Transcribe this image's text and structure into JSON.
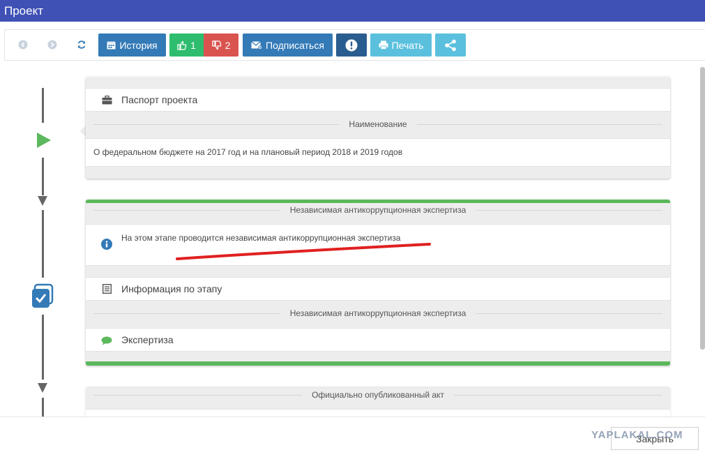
{
  "window": {
    "title": "Проект"
  },
  "toolbar": {
    "history_label": "История",
    "likes_count": "1",
    "dislikes_count": "2",
    "subscribe_label": "Подписаться",
    "print_label": "Печать"
  },
  "passport_card": {
    "header_label": "Паспорт проекта",
    "name_heading": "Наименование",
    "name_value": "О федеральном бюджете на 2017 год и на плановый период 2018 и 2019 годов"
  },
  "expertise_card": {
    "stage_heading": "Независимая антикоррупционная экспертиза",
    "stage_info": "На этом этапе проводится независимая антикоррупционная экспертиза",
    "stage_details_label": "Информация по этапу",
    "sub_heading": "Независимая антикоррупционная экспертиза",
    "expertise_label": "Экспертиза"
  },
  "published_card": {
    "heading": "Официально опубликованный акт"
  },
  "footer": {
    "close_label": "Закрыть",
    "watermark": "YAPLAKAL.COM"
  },
  "colors": {
    "title_bar": "#3f51b5",
    "history_button": "#337ab7",
    "like_button": "#2ebd6f",
    "dislike_button": "#d9534f",
    "print_button": "#5bc0de",
    "stage_active": "#5cb85c",
    "annotation_line": "#e02020"
  }
}
